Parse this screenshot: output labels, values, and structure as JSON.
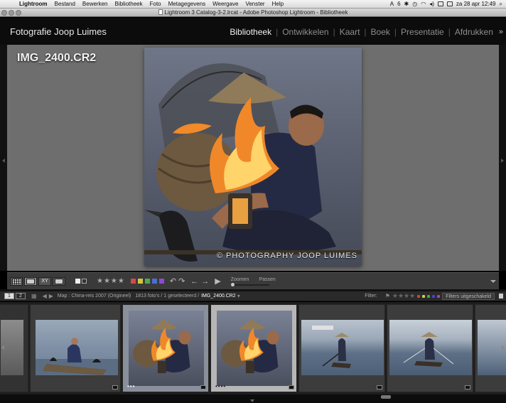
{
  "menubar": {
    "items": [
      "Lightroom",
      "Bestand",
      "Bewerken",
      "Bibliotheek",
      "Foto",
      "Metagegevens",
      "Weergave",
      "Venster",
      "Help"
    ],
    "status_badge": "6",
    "clock": "za 28 apr  12:49"
  },
  "window": {
    "title": "Lightroom 3 Catalog-3-2.lrcat - Adobe Photoshop Lightroom - Bibliotheek"
  },
  "identity_plate": "Fotografie Joop Luimes",
  "modules": [
    "Bibliotheek",
    "Ontwikkelen",
    "Kaart",
    "Boek",
    "Presentatie",
    "Afdrukken"
  ],
  "modules_more": "»",
  "loupe": {
    "filename": "IMG_2400.CR2",
    "watermark": "© PHOTOGRAPHY JOOP LUIMES"
  },
  "toolbar": {
    "stars": "★★★★",
    "color_labels": [
      "#d24a4a",
      "#d6c542",
      "#4fa94f",
      "#4a6fd2",
      "#8e4ad2"
    ],
    "zoom_label": "Zoomen",
    "fit_label": "Passen"
  },
  "filmstrip_header": {
    "page1": "1",
    "page2": "2",
    "path_prefix": "Map : China-reis 2007 (Origineel)",
    "count": "1813 foto's / 1 geselecteerd /",
    "current_file": "IMG_2400.CR2",
    "filter_label": "Filter:",
    "filter_stars": "★★★★",
    "filter_colors": [
      "#c44",
      "#cc4",
      "#4a4",
      "#44c",
      "#a4a"
    ],
    "filter_select": "Filters uitgeschakeld"
  },
  "filmstrip": {
    "items": [
      {
        "id": "thumb-1",
        "dots": ""
      },
      {
        "id": "thumb-2",
        "dots": ""
      },
      {
        "id": "thumb-3",
        "dots": "•••"
      },
      {
        "id": "thumb-4",
        "dots": "••••"
      },
      {
        "id": "thumb-5",
        "dots": ""
      },
      {
        "id": "thumb-6",
        "dots": ""
      },
      {
        "id": "thumb-7",
        "dots": ""
      }
    ]
  }
}
